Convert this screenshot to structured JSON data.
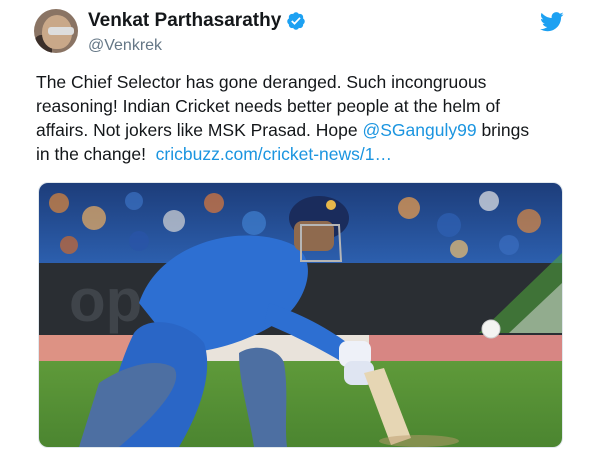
{
  "tweet": {
    "author_name": "Venkat Parthasarathy",
    "author_handle": "@Venkrek",
    "text_lines": [
      "The Chief Selector has gone deranged. Such incongruous",
      "reasoning! Indian Cricket needs better people at the helm of",
      "affairs. Not jokers like MSK Prasad. Hope "
    ],
    "mention": "@SGanguly99",
    "text_after_mention": " brings",
    "line4_prefix": "in the change!  ",
    "link": "cricbuzz.com/cricket-news/1…",
    "media_alt": "Cricketer in blue kit playing a shot"
  },
  "colors": {
    "link_blue": "#1b95e0",
    "verified_blue": "#1da1f2",
    "text": "#14171a",
    "handle_gray": "#657786"
  },
  "icons": {
    "verified": "verified-badge-icon",
    "brand": "twitter-bird-icon"
  }
}
